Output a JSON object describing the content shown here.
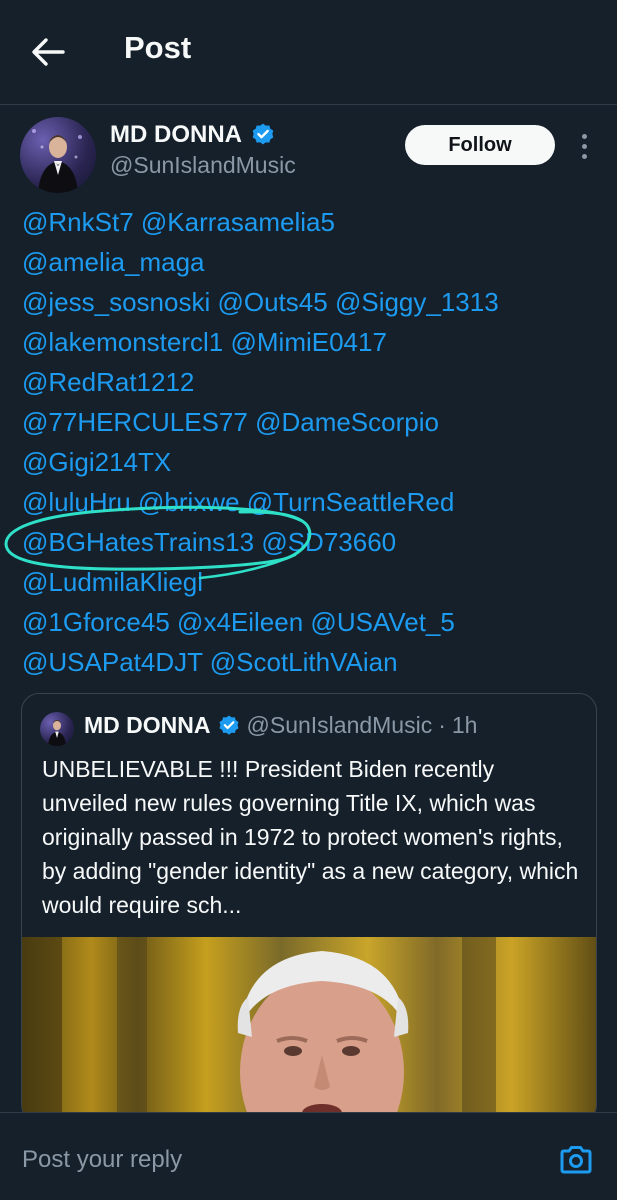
{
  "header": {
    "title": "Post",
    "back_icon": "arrow-left-icon"
  },
  "author": {
    "name": "MD DONNA",
    "handle": "@SunIslandMusic",
    "verified": true,
    "follow_label": "Follow"
  },
  "mentions": [
    [
      "@RnkSt7",
      "@Karrasamelia5"
    ],
    [
      "@amelia_maga"
    ],
    [
      "@jess_sosnoski",
      "@Outs45",
      "@Siggy_1313"
    ],
    [
      "@lakemonstercl1",
      "@MimiE0417"
    ],
    [
      "@RedRat1212"
    ],
    [
      "@77HERCULES77",
      "@DameScorpio"
    ],
    [
      "@Gigi214TX"
    ],
    [
      "@luluHru",
      "@brixwe",
      "@TurnSeattleRed"
    ],
    [
      "@BGHatesTrains13",
      "@SD73660"
    ],
    [
      "@LudmilaKliegl"
    ],
    [
      "@1Gforce45",
      "@x4Eileen",
      "@USAVet_5"
    ],
    [
      "@USAPat4DJT",
      "@ScotLithVAian"
    ]
  ],
  "annotation": {
    "color": "#2fe0c8",
    "circled_mention": "@BGHatesTrains13"
  },
  "quote": {
    "name": "MD DONNA",
    "handle": "@SunIslandMusic",
    "separator": "·",
    "time": "1h",
    "text": "UNBELIEVABLE !!! President Biden recently unveiled new rules governing Title IX, which was originally passed in 1972 to protect women's rights, by adding \"gender identity\" as a new category, which would require sch..."
  },
  "reply": {
    "placeholder": "Post your reply",
    "camera_icon": "camera-icon"
  },
  "colors": {
    "background": "#15202b",
    "link": "#1d9bf0",
    "secondary_text": "#8b98a5",
    "verified": "#1d9bf0"
  }
}
